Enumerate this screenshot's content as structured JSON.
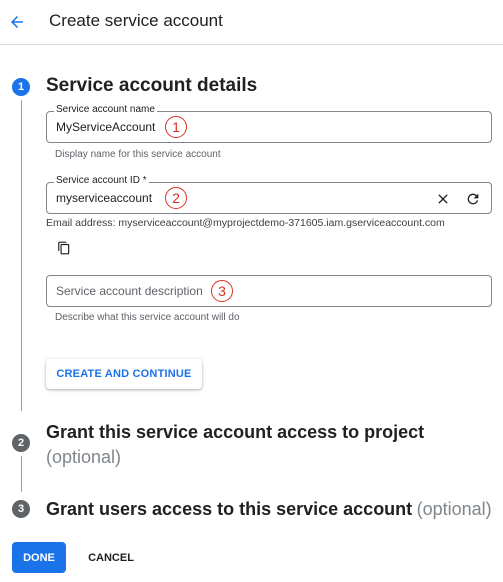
{
  "header": {
    "title": "Create service account"
  },
  "colors": {
    "accent": "#1a73e8",
    "callout": "#d93025",
    "muted": "#5f6368"
  },
  "steps": [
    {
      "number": "1",
      "title": "Service account details"
    },
    {
      "number": "2",
      "title": "Grant this service account access to project",
      "optional": "(optional)"
    },
    {
      "number": "3",
      "title": "Grant users access to this service account",
      "optional": "(optional)"
    }
  ],
  "form": {
    "name": {
      "label": "Service account name",
      "value": "MyServiceAccount",
      "hint": "Display name for this service account"
    },
    "id": {
      "label": "Service account ID *",
      "value": "myserviceaccount"
    },
    "email": "Email address: myserviceaccount@myprojectdemo-371605.iam.gserviceaccount.com",
    "description": {
      "placeholder": "Service account description",
      "hint": "Describe what this service account will do"
    }
  },
  "callouts": [
    "1",
    "2",
    "3"
  ],
  "buttons": {
    "create_continue": "CREATE AND CONTINUE",
    "done": "DONE",
    "cancel": "CANCEL"
  },
  "icons": {
    "back": "arrow-back-icon",
    "clear": "close-icon",
    "refresh": "refresh-icon",
    "copy": "copy-icon"
  }
}
